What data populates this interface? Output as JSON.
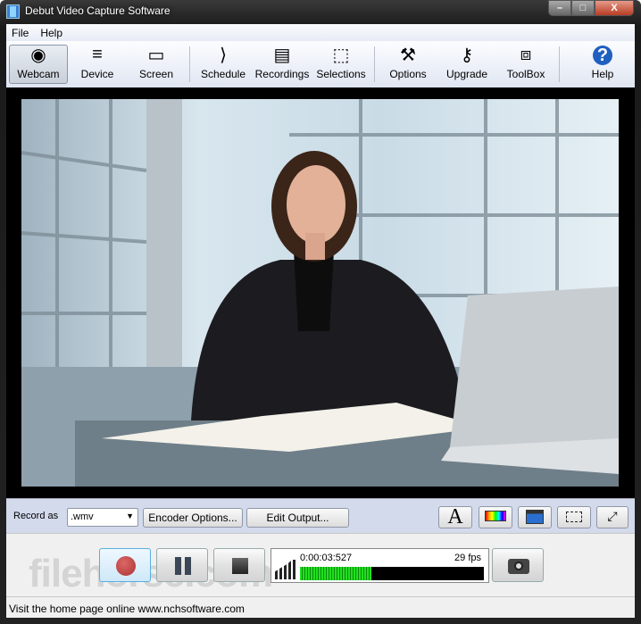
{
  "window": {
    "title": "Debut Video Capture Software",
    "controls": [
      "minimize",
      "maximize",
      "close"
    ]
  },
  "menu": [
    "File",
    "Help"
  ],
  "toolbar": [
    {
      "label": "Webcam",
      "icon": "webcam-icon",
      "active": true
    },
    {
      "label": "Device",
      "icon": "device-cables-icon"
    },
    {
      "label": "Screen",
      "icon": "screen-icon"
    },
    {
      "label": "Schedule",
      "icon": "schedule-icon"
    },
    {
      "label": "Recordings",
      "icon": "recordings-icon"
    },
    {
      "label": "Selections",
      "icon": "selection-icon"
    },
    {
      "label": "Options",
      "icon": "options-tools-icon"
    },
    {
      "label": "Upgrade",
      "icon": "upgrade-key-icon"
    },
    {
      "label": "ToolBox",
      "icon": "toolbox-icon"
    },
    {
      "label": "Help",
      "icon": "help-icon"
    }
  ],
  "record": {
    "label": "Record as",
    "format": ".wmv",
    "encoder_options": "Encoder Options...",
    "edit_output": "Edit Output..."
  },
  "tools": [
    "text-overlay-icon",
    "color-adjust-icon",
    "video-effects-icon",
    "selection-crop-icon",
    "fullscreen-icon"
  ],
  "playback": {
    "time": "0:00:03:527",
    "fps": "29 fps",
    "level_percent": 39
  },
  "status": "Visit the home page online www.nchsoftware.com",
  "watermark": "filehorse.com"
}
